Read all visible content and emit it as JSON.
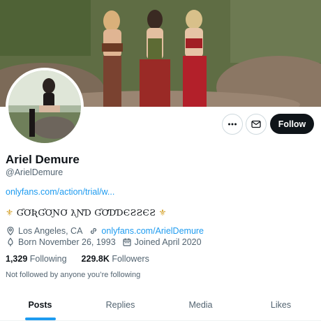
{
  "profile": {
    "name": "Ariel Demure",
    "handle": "@ArielDemure",
    "link": "onlyfans.com/action/trial/w...",
    "bio_crown_left": "⚜",
    "bio_text": "ƓƠƦƓƠƝƠ ƛƝƊ ƓƠƊƊЄƧƧЄƧ",
    "bio_crown_right": "⚜",
    "location": "Los Angeles, CA",
    "website": "onlyfans.com/ArielDemure",
    "born": "Born November 26, 1993",
    "joined": "Joined April 2020",
    "following_count": "1,329",
    "following_label": "Following",
    "followers_count": "229.8K",
    "followers_label": "Followers",
    "not_followed": "Not followed by anyone you’re following"
  },
  "actions": {
    "follow_label": "Follow"
  },
  "tabs": [
    {
      "label": "Posts",
      "active": true
    },
    {
      "label": "Replies",
      "active": false
    },
    {
      "label": "Media",
      "active": false
    },
    {
      "label": "Likes",
      "active": false
    }
  ],
  "colors": {
    "accent": "#1d9bf0",
    "text": "#0f1419",
    "secondary": "#536471"
  },
  "icons": [
    "more-icon",
    "mail-icon",
    "location-icon",
    "link-icon",
    "birthday-icon",
    "calendar-icon"
  ]
}
